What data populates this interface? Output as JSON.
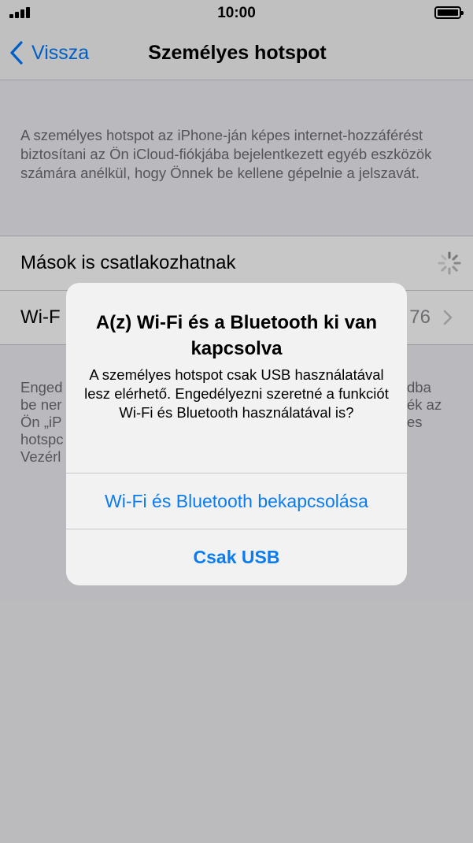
{
  "status_bar": {
    "time": "10:00"
  },
  "nav": {
    "back_label": "Vissza",
    "title": "Személyes hotspot"
  },
  "description": "A személyes hotspot az iPhone-ján képes internet-hozzáférést biztosítani az Ön iCloud-fiókjába bejelentkezett egyéb eszközök számára anélkül, hogy Önnek be kellene gépelnie a jelszavát.",
  "settings": {
    "allow_others_label": "Mások is csatlakozhatnak",
    "wifi_password_label": "Wi-F",
    "wifi_password_value": "76"
  },
  "footer_lines": [
    "Enged",
    "be ner",
    "Ön „iP",
    "hotspc",
    "Vezérl"
  ],
  "footer_right_lines": [
    "dba",
    "ék az",
    "es"
  ],
  "alert": {
    "title": "A(z) Wi-Fi és a Bluetooth ki van kapcsolva",
    "message": "A személyes hotspot csak USB használatával lesz elérhető. Engedélyezni szeretné a funkciót Wi-Fi és Bluetooth használatával is?",
    "button_primary": "Wi-Fi és Bluetooth bekapcsolása",
    "button_secondary": "Csak USB"
  },
  "colors": {
    "accent": "#007aff",
    "secondary_text": "#6d6d72"
  }
}
